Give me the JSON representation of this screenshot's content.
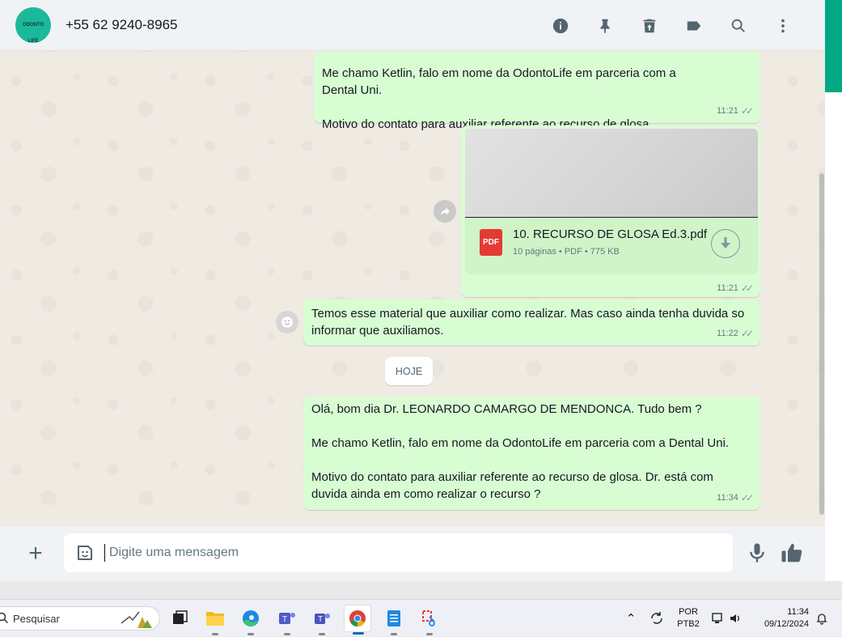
{
  "header": {
    "contact": "+55 62 9240-8965",
    "avatar_text": "ODONTO LIFE"
  },
  "messages": [
    {
      "text": "Me chamo Ketlin, falo em nome da OdontoLife em parceria com a Dental Uni.\n\nMotivo do contato para auxiliar referente ao recurso de glosa",
      "time": "11:21",
      "status": "read"
    },
    {
      "type": "document",
      "file_icon": "PDF",
      "file_name": "10. RECURSO DE GLOSA Ed.3.pdf",
      "file_meta": "10 páginas • PDF • 775 KB",
      "time": "11:21",
      "status": "read"
    },
    {
      "text": "Temos esse material que auxiliar como realizar. Mas caso ainda tenha duvida so informar que auxiliamos.",
      "time": "11:22",
      "status": "read"
    },
    {
      "text": "Olá, bom dia Dr. LEONARDO CAMARGO DE MENDONCA. Tudo bem ?\n\nMe chamo Ketlin, falo em nome da OdontoLife em parceria com a Dental Uni.\n\nMotivo do contato para auxiliar referente ao recurso de glosa. Dr. está com duvida ainda em como realizar o recurso ?",
      "time": "11:34",
      "status": "read"
    }
  ],
  "date_chip": "HOJE",
  "composer": {
    "placeholder": "Digite uma mensagem"
  },
  "taskbar": {
    "search_label": "Pesquisar",
    "language_line1": "POR",
    "language_line2": "PTB2",
    "time": "11:34",
    "date": "09/12/2024"
  },
  "colors": {
    "accent": "#00a884",
    "outgoing_bubble": "#d9fdd3",
    "chat_background": "#efeae2"
  },
  "icons": {
    "header": [
      "info-icon",
      "pin-icon",
      "delete-icon",
      "label-icon",
      "search-icon",
      "menu-icon"
    ],
    "composer": [
      "plus-icon",
      "sticker-icon",
      "mic-icon",
      "thumbs-up-icon"
    ]
  }
}
